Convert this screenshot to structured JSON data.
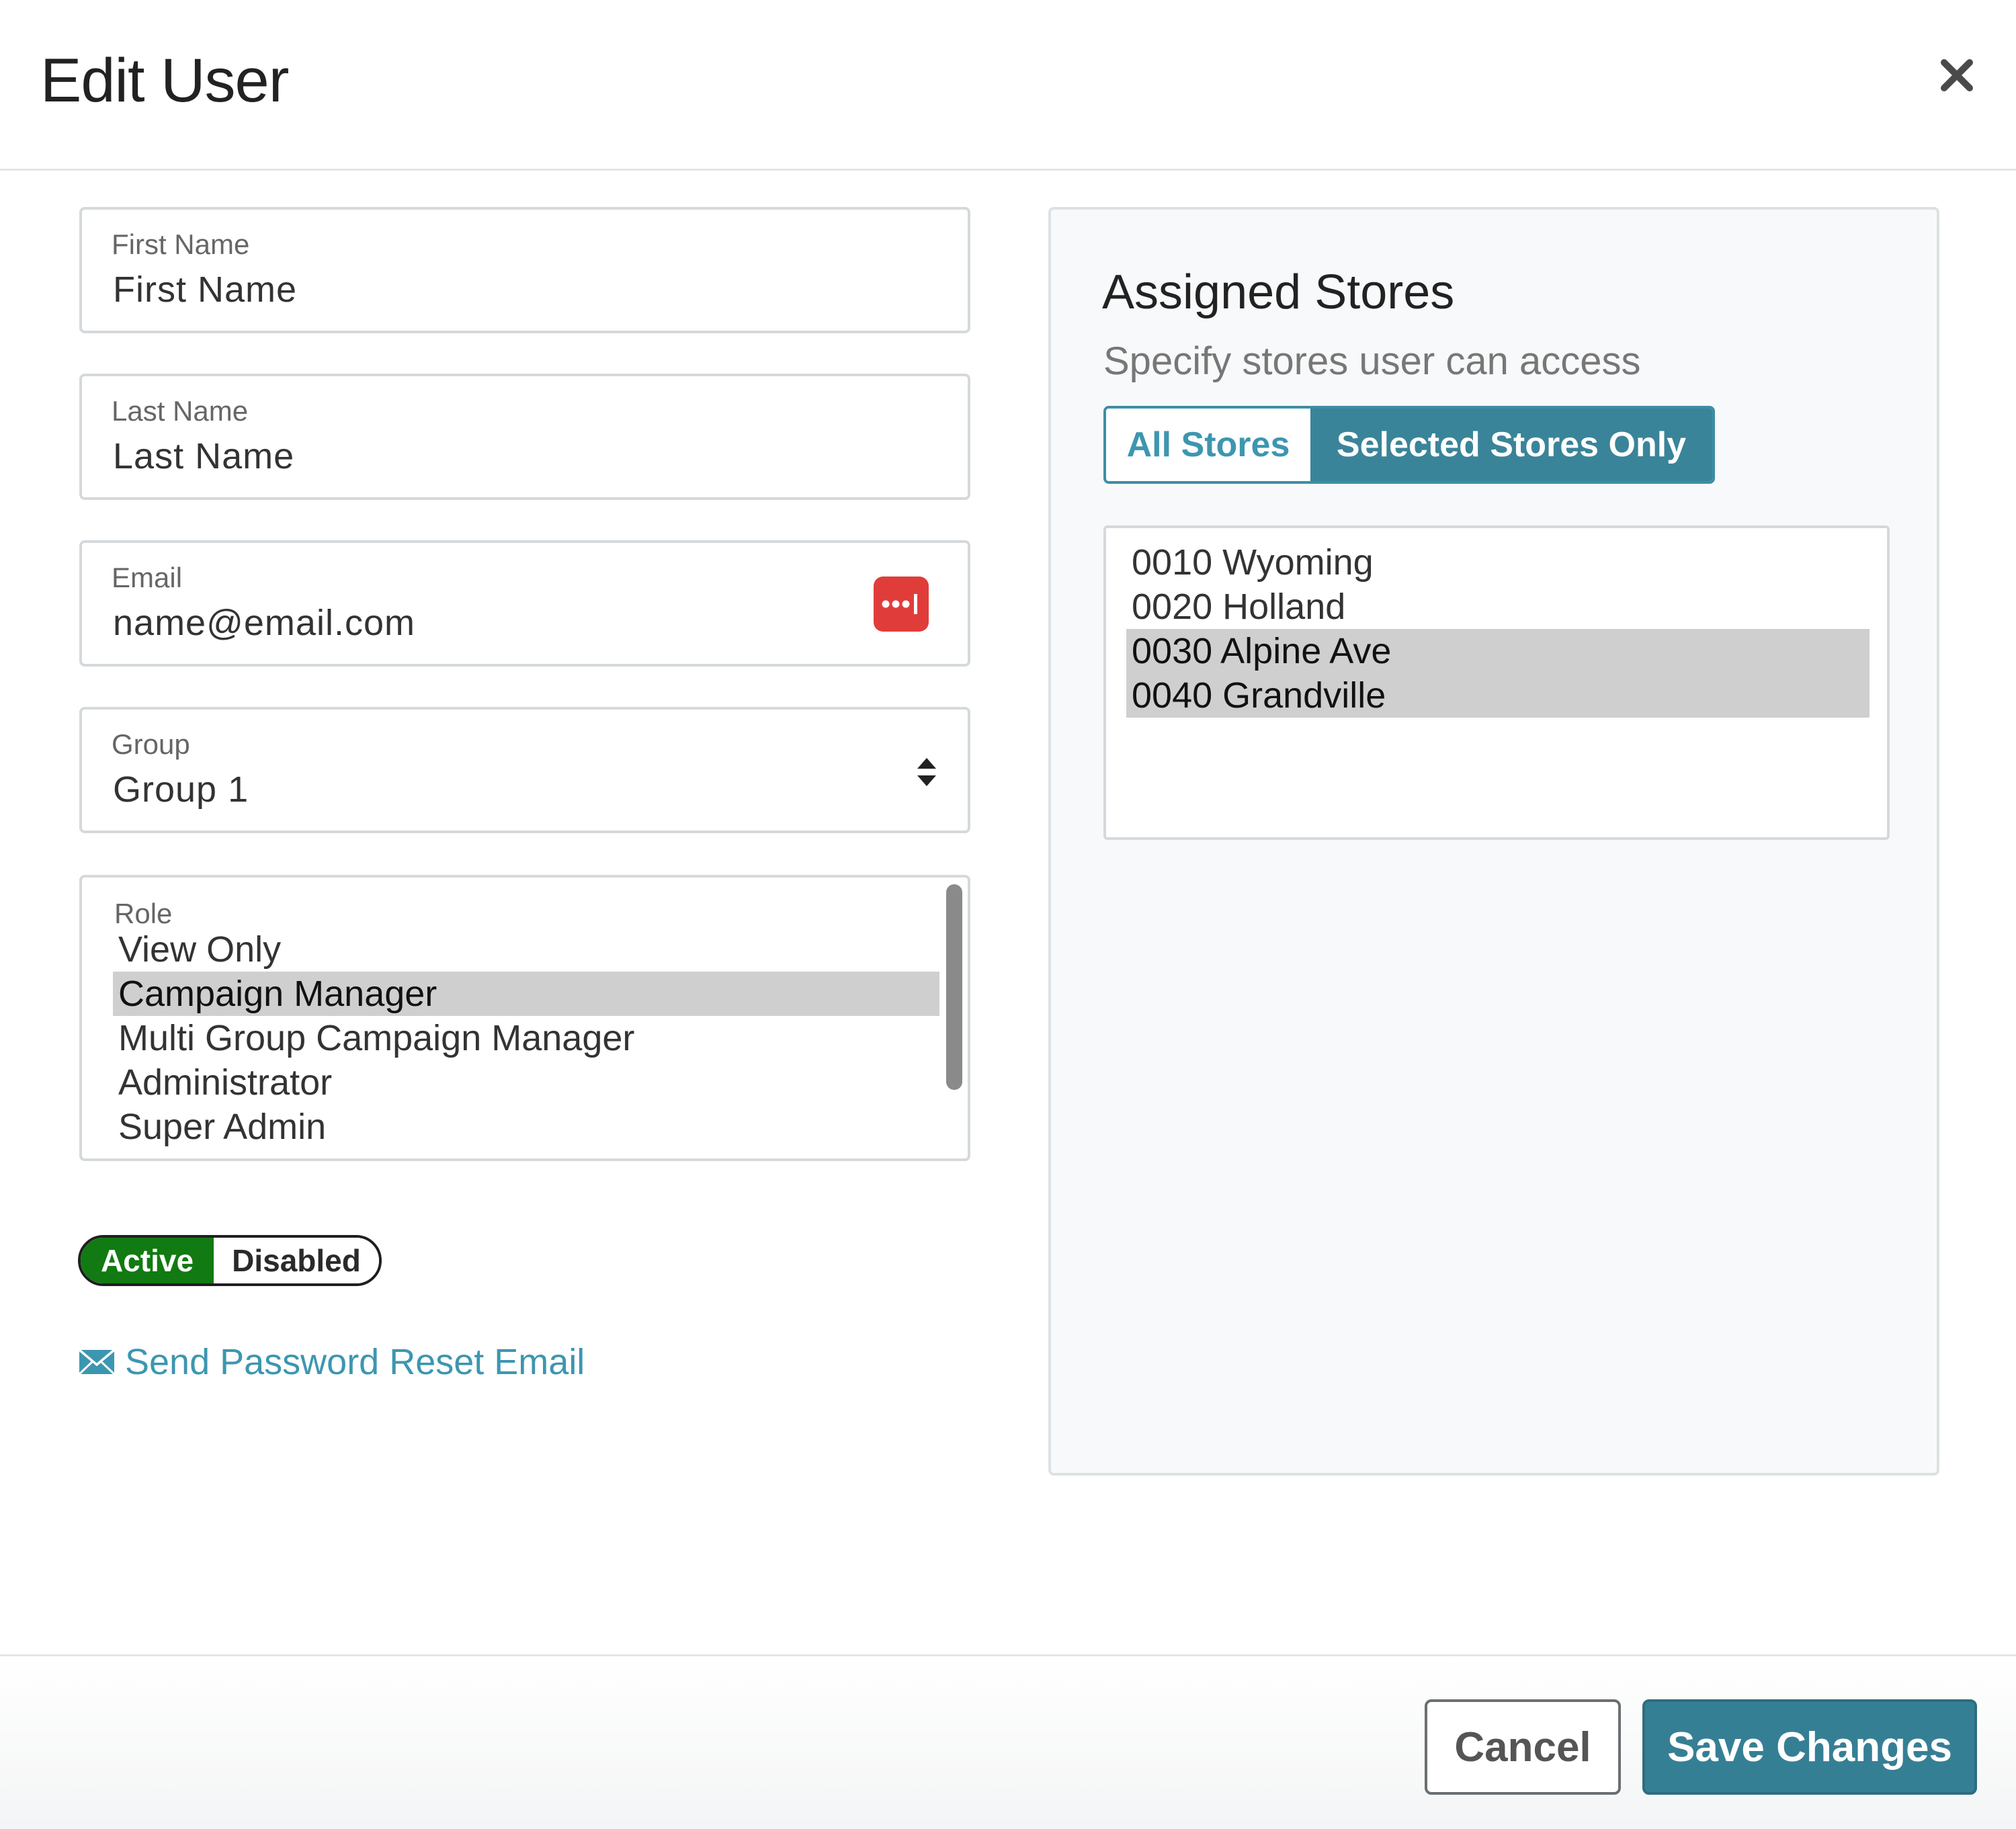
{
  "header": {
    "title": "Edit User",
    "close_icon": "close-icon"
  },
  "form": {
    "first_name": {
      "label": "First Name",
      "value": "First Name"
    },
    "last_name": {
      "label": "Last Name",
      "value": "Last Name"
    },
    "email": {
      "label": "Email",
      "value": "name@email.com",
      "icon": "password-manager-icon"
    },
    "group": {
      "label": "Group",
      "value": "Group 1",
      "icon": "select-arrows-icon"
    },
    "role": {
      "label": "Role",
      "options": [
        "View Only",
        "Campaign Manager",
        "Multi Group Campaign Manager",
        "Administrator",
        "Super Admin"
      ],
      "selected": "Campaign Manager"
    },
    "status": {
      "active_label": "Active",
      "disabled_label": "Disabled",
      "selected": "Active"
    },
    "reset_link": {
      "label": "Send Password Reset Email",
      "icon": "envelope-icon"
    }
  },
  "stores": {
    "title": "Assigned Stores",
    "subtitle": "Specify stores user can access",
    "toggle": {
      "all_label": "All Stores",
      "selected_label": "Selected Stores Only",
      "active": "Selected Stores Only"
    },
    "items": [
      "0010 Wyoming",
      "0020 Holland",
      "0030 Alpine Ave",
      "0040 Grandville"
    ],
    "selected_items": [
      "0030 Alpine Ave",
      "0040 Grandville"
    ]
  },
  "footer": {
    "cancel_label": "Cancel",
    "save_label": "Save Changes"
  },
  "colors": {
    "accent": "#3a8499",
    "link": "#3d96b0",
    "active_green": "#127a12",
    "password_icon_red": "#e03d3a",
    "selection_gray": "#cfcfcf"
  }
}
